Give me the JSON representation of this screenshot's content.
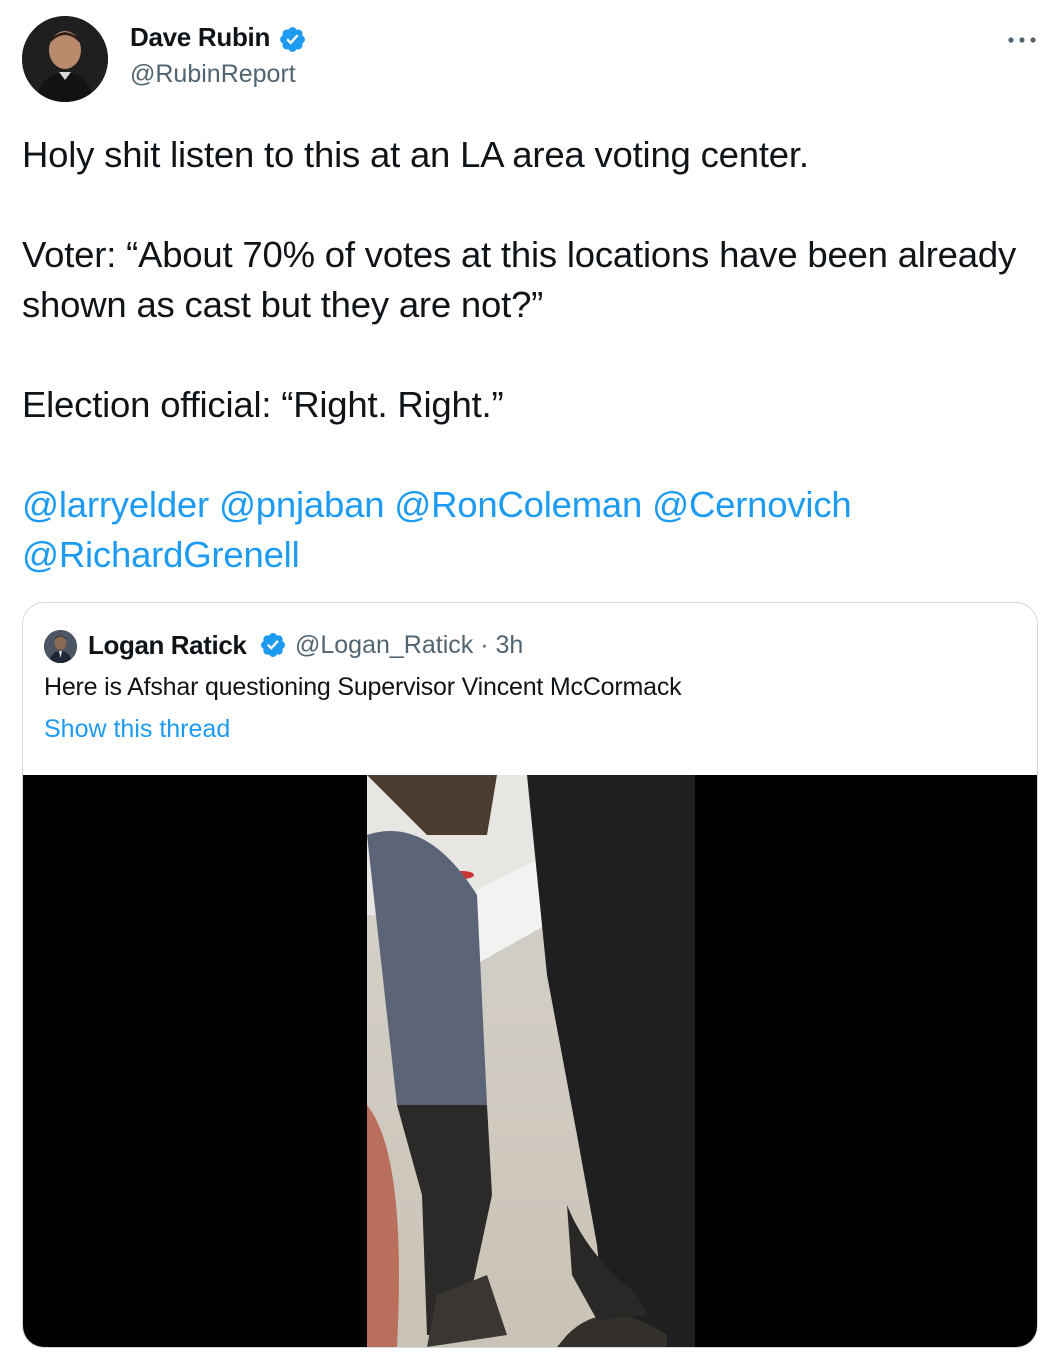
{
  "author": {
    "name": "Dave Rubin",
    "handle": "@RubinReport",
    "verified": true,
    "avatar_icon": "avatar-photo"
  },
  "menu_icon": "more-horizontal-icon",
  "tweet": {
    "line1": "Holy shit listen to this at an LA area voting center.",
    "line2": "Voter: “About 70% of votes at this locations have been already shown as cast but they are not?”",
    "line3": "Election official: “Right. Right.”",
    "mentions": [
      "@larryelder",
      "@pnjaban",
      "@RonColeman",
      "@Cernovich",
      "@RichardGrenell"
    ]
  },
  "quoted": {
    "name": "Logan Ratick",
    "verified": true,
    "handle_time": "@Logan_Ratick · 3h",
    "text": "Here is Afshar questioning Supervisor Vincent McCormack",
    "show_thread": "Show this thread",
    "media": "video"
  },
  "colors": {
    "link": "#1d9bf0",
    "text": "#0f1419",
    "secondary": "#536471",
    "border": "#cfd9de"
  }
}
